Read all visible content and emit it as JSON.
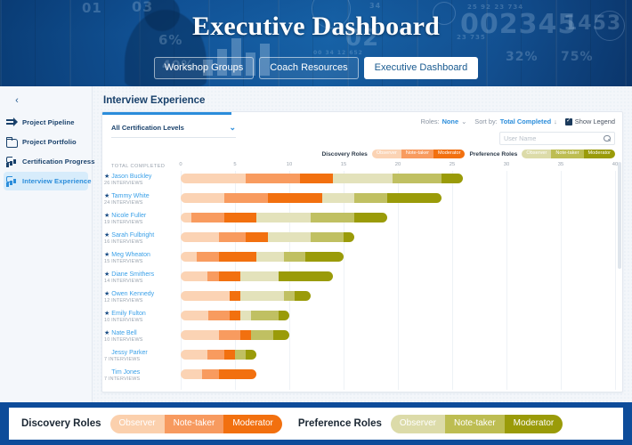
{
  "hero": {
    "title": "Executive Dashboard",
    "tabs": [
      {
        "label": "Workshop Groups",
        "active": false
      },
      {
        "label": "Coach Resources",
        "active": false
      },
      {
        "label": "Executive Dashboard",
        "active": true
      }
    ],
    "ghost_numbers": [
      "25 92 23 734",
      "002345",
      "1453",
      "23 735",
      "00 34 12 652",
      "32%",
      "75%",
      "6%",
      "40%",
      "02",
      "03",
      "01",
      "34"
    ]
  },
  "sidebar": {
    "collapse_icon": "‹",
    "items": [
      {
        "label": "Project Pipeline",
        "icon": "pipeline-icon",
        "active": false
      },
      {
        "label": "Project Portfolio",
        "icon": "folder-icon",
        "active": false
      },
      {
        "label": "Certification Progress",
        "icon": "bar-chart-up-icon",
        "active": false
      },
      {
        "label": "Interview Experience",
        "icon": "bar-chart-up-icon",
        "active": true
      }
    ]
  },
  "main": {
    "page_title": "Interview Experience",
    "filter": {
      "label": "All Certification Levels",
      "chevron": "⌄"
    },
    "controls": {
      "roles_label": "Roles:",
      "roles_value": "None",
      "roles_chevron": "⌄",
      "sort_label": "Sort by:",
      "sort_value": "Total Completed",
      "sort_arrow": "↓",
      "show_legend_label": "Show Legend",
      "show_legend_checked": true,
      "check_glyph": "✓"
    },
    "search": {
      "placeholder": "User Name",
      "value": "",
      "icon": "search-icon"
    }
  },
  "legend": {
    "discovery_title": "Discovery Roles",
    "preference_title": "Preference Roles",
    "roles": [
      "Observer",
      "Note-taker",
      "Moderator"
    ],
    "discovery_colors": [
      "#fbd3b4",
      "#f89b5f",
      "#f2700f"
    ],
    "preference_colors": [
      "#dcdba9",
      "#bdbd52",
      "#9a9b09"
    ]
  },
  "chart_data": {
    "type": "bar",
    "subtype": "stacked-horizontal",
    "title": "Interview Experience",
    "xlabel": "",
    "ylabel": "TOTAL COMPLETED",
    "xlim": [
      0,
      40
    ],
    "xticks": [
      0,
      5,
      10,
      15,
      20,
      25,
      30,
      35,
      40
    ],
    "grid": true,
    "legend_position": "top-right",
    "series": [
      {
        "name": "Discovery / Observer",
        "color": "#fbd3b4"
      },
      {
        "name": "Discovery / Note-taker",
        "color": "#f89b5f"
      },
      {
        "name": "Discovery / Moderator",
        "color": "#f2700f"
      },
      {
        "name": "Preference / Observer",
        "color": "#e3e2bb"
      },
      {
        "name": "Preference / Note-taker",
        "color": "#c0c062"
      },
      {
        "name": "Preference / Moderator",
        "color": "#9a9b09"
      }
    ],
    "rows": [
      {
        "name": "Jason Buckley",
        "starred": true,
        "interviews": "26 INTERVIEWS",
        "total": 26,
        "values": [
          6,
          5,
          3,
          5.5,
          4.5,
          2
        ],
        "hatched": false
      },
      {
        "name": "Tammy White",
        "starred": true,
        "interviews": "24 INTERVIEWS",
        "total": 24,
        "values": [
          4,
          4,
          5,
          3,
          3,
          5
        ],
        "hatched": false
      },
      {
        "name": "Nicole Fuller",
        "starred": true,
        "interviews": "19 INTERVIEWS",
        "total": 19,
        "values": [
          1,
          3,
          3,
          5,
          4,
          3
        ],
        "hatched": false
      },
      {
        "name": "Sarah Fulbright",
        "starred": true,
        "interviews": "16 INTERVIEWS",
        "total": 16,
        "values": [
          3.5,
          2.5,
          2,
          4,
          3,
          1
        ],
        "hatched": false
      },
      {
        "name": "Meg Wheaton",
        "starred": true,
        "interviews": "15 INTERVIEWS",
        "total": 15,
        "values": [
          1.5,
          2,
          3.5,
          2.5,
          2,
          3.5
        ],
        "hatched": false
      },
      {
        "name": "Diane Smithers",
        "starred": true,
        "interviews": "14 INTERVIEWS",
        "total": 14,
        "values": [
          2.5,
          1,
          2,
          3.5,
          0,
          5
        ],
        "hatched": false
      },
      {
        "name": "Owen Kennedy",
        "starred": true,
        "interviews": "12 INTERVIEWS",
        "total": 12,
        "values": [
          4.5,
          0,
          1,
          4,
          1,
          1.5
        ],
        "hatched": false
      },
      {
        "name": "Emily Fulton",
        "starred": true,
        "interviews": "10 INTERVIEWS",
        "total": 10,
        "values": [
          2.5,
          2,
          1,
          1,
          2.5,
          1
        ],
        "hatched": false
      },
      {
        "name": "Nate Bell",
        "starred": true,
        "interviews": "10 INTERVIEWS",
        "total": 10,
        "values": [
          3.5,
          2,
          1,
          0,
          2,
          1.5
        ],
        "hatched": false
      },
      {
        "name": "Jessy Parker",
        "starred": false,
        "interviews": "7 INTERVIEWS",
        "total": 7,
        "values": [
          2.5,
          1.5,
          1,
          0,
          1,
          1
        ],
        "hatched": false
      },
      {
        "name": "Tim Jones",
        "starred": false,
        "interviews": "7 INTERVIEWS",
        "total": 7,
        "values": [
          2,
          1.5,
          3.5,
          0,
          0,
          0
        ],
        "hatched": true
      }
    ]
  },
  "footer": {
    "discovery_title": "Discovery Roles",
    "preference_title": "Preference Roles",
    "roles": [
      "Observer",
      "Note-taker",
      "Moderator"
    ],
    "discovery_colors": [
      "#fbd0ad",
      "#f79a5f",
      "#f2700f"
    ],
    "preference_colors": [
      "#dcdba9",
      "#bdbd52",
      "#9a9b09"
    ]
  },
  "colors": {
    "brand_blue": "#0d4c9a",
    "accent_blue": "#2b8ddb",
    "navy": "#19416b"
  }
}
